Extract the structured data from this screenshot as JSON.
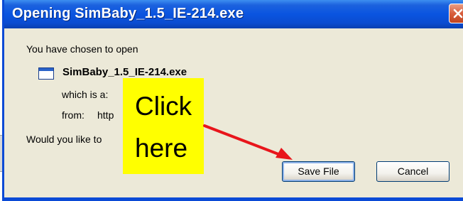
{
  "window": {
    "title": "Opening SimBaby_1.5_IE-214.exe",
    "close_icon": "close-icon"
  },
  "content": {
    "intro": "You have chosen to open",
    "file_name": "SimBaby_1.5_IE-214.exe",
    "file_icon": "application-file-icon",
    "which_is_label": "which is a:",
    "from_label": "from:",
    "from_value": "http",
    "question": "Would you like to"
  },
  "buttons": {
    "save_file": "Save File",
    "cancel": "Cancel"
  },
  "callout": {
    "line1": "Click",
    "line2": "here",
    "background": "#ffff00",
    "arrow_color": "#e8151b"
  },
  "colors": {
    "titlebar": "#0a54e0",
    "dialog_bg": "#ece9d8"
  }
}
